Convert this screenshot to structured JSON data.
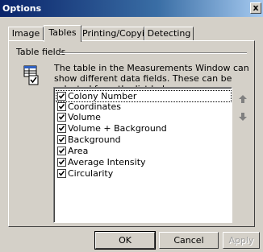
{
  "window": {
    "title": "Options",
    "close_label": "x"
  },
  "tabs": [
    {
      "label": "Image"
    },
    {
      "label": "Tables"
    },
    {
      "label": "Printing/Copying"
    },
    {
      "label": "Detecting"
    }
  ],
  "active_tab": "Tables",
  "group": {
    "label": "Table fields"
  },
  "description": "The table in the Measurements Window can show different data fields. These can be selected from the list below:",
  "fields": [
    {
      "label": "Colony Number",
      "checked": true
    },
    {
      "label": "Coordinates",
      "checked": true
    },
    {
      "label": "Volume",
      "checked": true
    },
    {
      "label": "Volume + Background",
      "checked": true
    },
    {
      "label": "Background",
      "checked": true
    },
    {
      "label": "Area",
      "checked": true
    },
    {
      "label": "Average Intensity",
      "checked": true
    },
    {
      "label": "Circularity",
      "checked": true
    }
  ],
  "buttons": {
    "ok": "OK",
    "cancel": "Cancel",
    "apply": "Apply"
  },
  "icons": {
    "move_up": "arrow-up-icon",
    "move_down": "arrow-down-icon",
    "table": "table-fields-icon"
  }
}
